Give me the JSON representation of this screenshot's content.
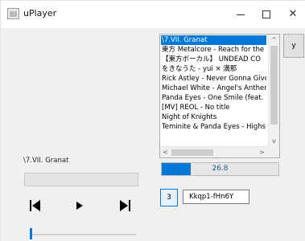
{
  "window": {
    "title": "uPlayer",
    "minimize_glyph": "—",
    "maximize_glyph": "☐",
    "close_glyph": "✕"
  },
  "song_list": {
    "items": [
      "\\7.VII. Granat",
      "東方 Metalcore - Reach for the",
      "【東方ボーカル】 UNDEAD CO",
      "をきなうた - yui × 満那",
      "Rick Astley - Never Gonna Give",
      "Michael White - Angel's Anther",
      "Panda Eyes - One Smile (feat.",
      "[MV] REOL - No title",
      "Night of Knights",
      "Teminite & Panda Eyes - Highs"
    ],
    "selected_index": 0,
    "scroll_up_glyph": "^",
    "scroll_down_glyph": "v",
    "scroll_left_glyph": "<",
    "scroll_right_glyph": ">"
  },
  "side_button": {
    "label": "y"
  },
  "progress": {
    "value_text": "26.8",
    "fill_fraction": 0.25
  },
  "number_button": {
    "label": "3"
  },
  "code_field": {
    "value": "Kkqp1-fHn6Y"
  },
  "now_playing": {
    "title": "\\7.VII. Granat"
  },
  "controls": {
    "prev_icon": "skip-previous-icon",
    "play_icon": "play-icon",
    "next_icon": "skip-next-icon"
  },
  "seek": {
    "position_fraction": 0.0
  },
  "colors": {
    "accent": "#0078d7",
    "client_bg": "#f0f0f0"
  }
}
